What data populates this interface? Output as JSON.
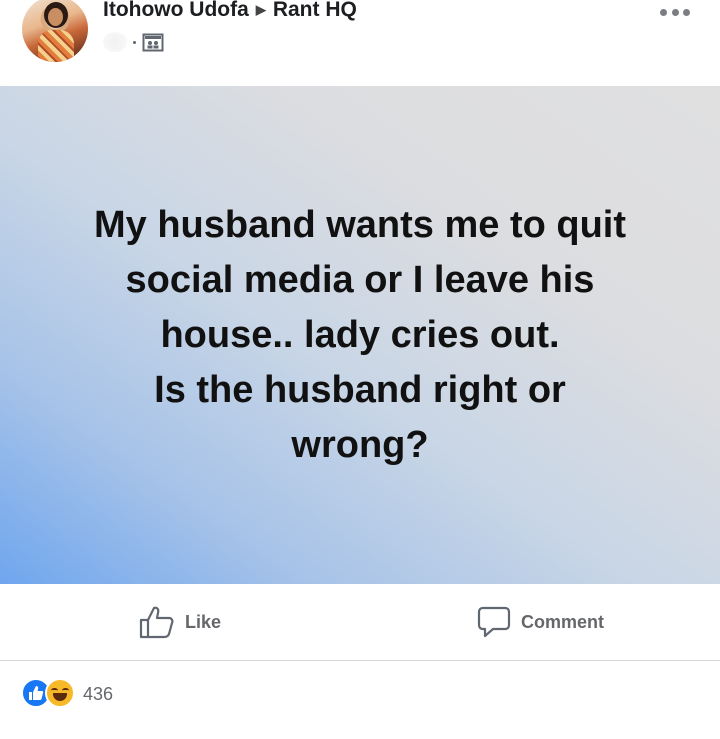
{
  "post": {
    "author": "Itohowo Udofa",
    "group": "Rant HQ",
    "text": "My husband wants me to quit\nsocial media or I leave his\nhouse.. lady cries out.\n   Is the husband right or\nwrong?"
  },
  "actions": {
    "like_label": "Like",
    "comment_label": "Comment"
  },
  "reactions": {
    "count": "436",
    "types": [
      "like",
      "haha"
    ]
  },
  "colors": {
    "like_blue": "#1877f2",
    "haha_yellow": "#f7b928",
    "action_gray": "#65676b"
  }
}
